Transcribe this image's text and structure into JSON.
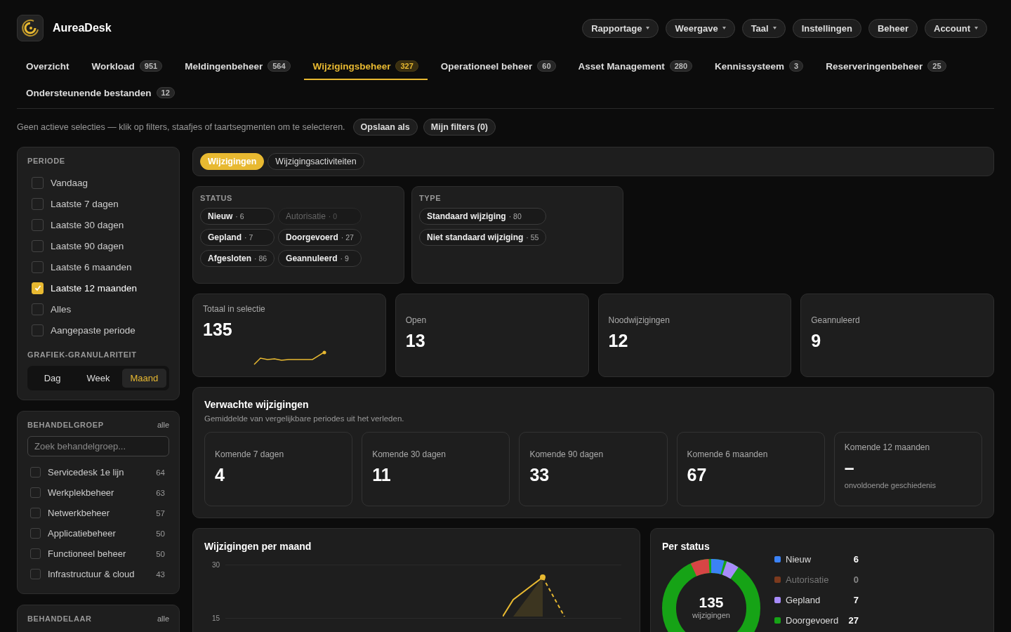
{
  "app": {
    "name": "AureaDesk"
  },
  "top_nav": [
    {
      "label": "Rapportage",
      "dropdown": true
    },
    {
      "label": "Weergave",
      "dropdown": true
    },
    {
      "label": "Taal",
      "dropdown": true
    },
    {
      "label": "Instellingen",
      "dropdown": false
    },
    {
      "label": "Beheer",
      "dropdown": false
    },
    {
      "label": "Account",
      "dropdown": true
    }
  ],
  "tabs": [
    {
      "label": "Overzicht",
      "selected": false
    },
    {
      "label": "Workload",
      "count": "951",
      "selected": false
    },
    {
      "label": "Meldingenbeheer",
      "count": "564",
      "selected": false
    },
    {
      "label": "Wijzigingsbeheer",
      "count": "327",
      "selected": true
    },
    {
      "label": "Operationeel beheer",
      "count": "60",
      "selected": false
    },
    {
      "label": "Asset Management",
      "count": "280",
      "selected": false
    },
    {
      "label": "Kennissysteem",
      "count": "3",
      "selected": false
    },
    {
      "label": "Reserveringenbeheer",
      "count": "25",
      "selected": false
    },
    {
      "label": "Ondersteunende bestanden",
      "count": "12",
      "selected": false
    }
  ],
  "selection_bar": {
    "hint": "Geen actieve selecties — klik op filters, staafjes of taartsegmenten om te selecteren.",
    "buttons": [
      "Opslaan als",
      "Mijn filters (0)"
    ]
  },
  "sidebar": {
    "periode": {
      "title": "PERIODE",
      "items": [
        {
          "label": "Vandaag",
          "checked": false
        },
        {
          "label": "Laatste 7 dagen",
          "checked": false
        },
        {
          "label": "Laatste 30 dagen",
          "checked": false
        },
        {
          "label": "Laatste 90 dagen",
          "checked": false
        },
        {
          "label": "Laatste 6 maanden",
          "checked": false
        },
        {
          "label": "Laatste 12 maanden",
          "checked": true
        },
        {
          "label": "Alles",
          "checked": false
        },
        {
          "label": "Aangepaste periode",
          "checked": false
        }
      ]
    },
    "granularity": {
      "title": "GRAFIEK-GRANULARITEIT",
      "options": [
        {
          "label": "Dag",
          "selected": false
        },
        {
          "label": "Week",
          "selected": false
        },
        {
          "label": "Maand",
          "selected": true
        }
      ]
    },
    "behandelgroep": {
      "title": "BEHANDELGROEP",
      "link": "alle",
      "search": {
        "placeholder": "Zoek behandelgroep..."
      },
      "items": [
        {
          "label": "Servicedesk 1e lijn",
          "count": "64",
          "checked": false
        },
        {
          "label": "Werkplekbeheer",
          "count": "63",
          "checked": false
        },
        {
          "label": "Netwerkbeheer",
          "count": "57",
          "checked": false
        },
        {
          "label": "Applicatiebeheer",
          "count": "50",
          "checked": false
        },
        {
          "label": "Functioneel beheer",
          "count": "50",
          "checked": false
        },
        {
          "label": "Infrastructuur & cloud",
          "count": "43",
          "checked": false
        }
      ]
    },
    "behandelaar": {
      "title": "BEHANDELAAR",
      "link": "alle"
    }
  },
  "view_tabs": [
    {
      "label": "Wijzigingen",
      "selected": true
    },
    {
      "label": "Wijzigingsactiviteiten",
      "selected": false
    }
  ],
  "filters": [
    {
      "title": "STATUS",
      "chips": [
        {
          "label": "Nieuw",
          "count": "· 6",
          "disabled": false
        },
        {
          "label": "Autorisatie",
          "count": "· 0",
          "disabled": true
        },
        {
          "label": "Gepland",
          "count": "· 7",
          "disabled": false
        },
        {
          "label": "Doorgevoerd",
          "count": "· 27",
          "disabled": false
        },
        {
          "label": "Afgesloten",
          "count": "· 86",
          "disabled": false
        },
        {
          "label": "Geannuleerd",
          "count": "· 9",
          "disabled": false
        }
      ]
    },
    {
      "title": "TYPE",
      "chips": [
        {
          "label": "Standaard wijziging",
          "count": "· 80",
          "disabled": false
        },
        {
          "label": "Niet standaard wijziging",
          "count": "· 55",
          "disabled": false
        }
      ]
    }
  ],
  "kpis": [
    {
      "label": "Totaal in selectie",
      "value": "135",
      "sparkline": true
    },
    {
      "label": "Open",
      "value": "13",
      "sparkline": false
    },
    {
      "label": "Noodwijzigingen",
      "value": "12",
      "sparkline": false
    },
    {
      "label": "Geannuleerd",
      "value": "9",
      "sparkline": false
    }
  ],
  "forecast": {
    "title": "Verwachte wijzigingen",
    "subtitle": "Gemiddelde van vergelijkbare periodes uit het verleden.",
    "cards": [
      {
        "label": "Komende 7 dagen",
        "value": "4"
      },
      {
        "label": "Komende 30 dagen",
        "value": "11"
      },
      {
        "label": "Komende 90 dagen",
        "value": "33"
      },
      {
        "label": "Komende 6 maanden",
        "value": "67"
      },
      {
        "label": "Komende 12 maanden",
        "value": "–",
        "note": "onvoldoende geschiedenis"
      }
    ]
  },
  "per_month": {
    "title": "Wijzigingen per maand",
    "y_ticks": [
      "30",
      "15"
    ]
  },
  "per_status": {
    "title": "Per status",
    "center_value": "135",
    "center_label": "wijzigingen",
    "legend": [
      {
        "label": "Nieuw",
        "value": "6",
        "color": "#3b82f6",
        "disabled": false
      },
      {
        "label": "Autorisatie",
        "value": "0",
        "color": "#7c3a1e",
        "disabled": true
      },
      {
        "label": "Gepland",
        "value": "7",
        "color": "#a78bfa",
        "disabled": false
      },
      {
        "label": "Doorgevoerd",
        "value": "27",
        "color": "#16a316",
        "disabled": false
      }
    ]
  }
}
